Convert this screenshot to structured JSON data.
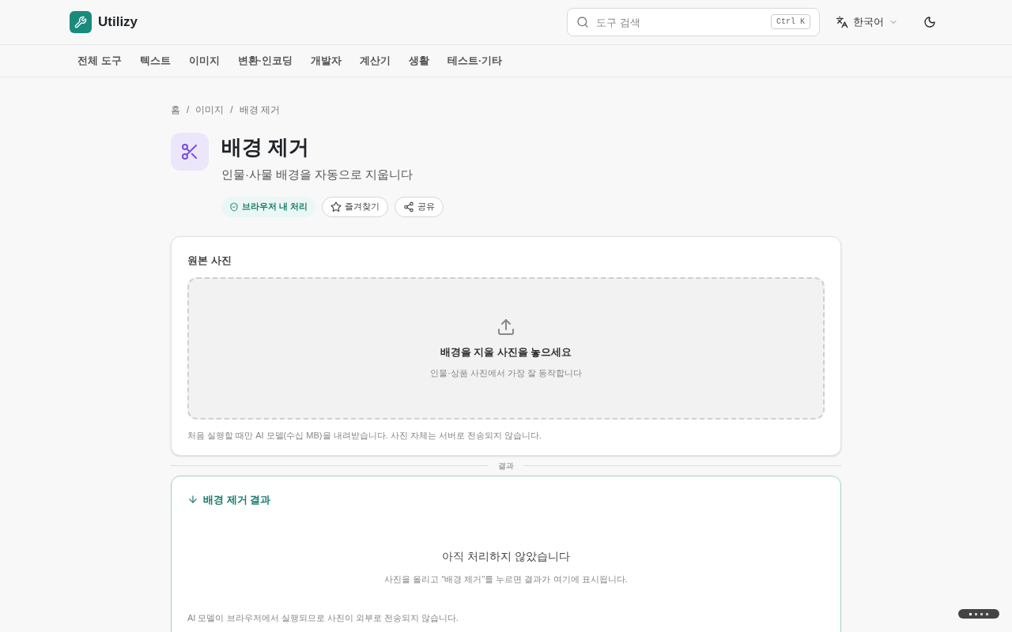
{
  "header": {
    "brand": "Utilizy",
    "search": {
      "placeholder": "도구 검색",
      "shortcut": "Ctrl K"
    },
    "language": "한국어"
  },
  "nav": [
    "전체 도구",
    "텍스트",
    "이미지",
    "변환·인코딩",
    "개발자",
    "계산기",
    "생활",
    "테스트·기타"
  ],
  "breadcrumb": {
    "separator": "/",
    "items": [
      "홈",
      "이미지",
      "배경 제거"
    ]
  },
  "tool": {
    "title": "배경 제거",
    "subtitle": "인물·사물 배경을 자동으로 지웁니다",
    "badge": "브라우저 내 처리",
    "actions": [
      {
        "kind": "favorite",
        "label": "즐겨찾기"
      },
      {
        "kind": "share",
        "label": "공유"
      }
    ]
  },
  "input_card": {
    "title": "원본 사진",
    "dropzone": {
      "title": "배경을 지울 사진을 놓으세요",
      "hint": "인물·상품 사진에서 가장 잘 동작합니다"
    },
    "note": "처음 실행할 때만 AI 모델(수십 MB)을 내려받습니다. 사진 자체는 서버로 전송되지 않습니다."
  },
  "divider": "결과",
  "result_card": {
    "title": "배경 제거 결과",
    "empty_title": "아직 처리하지 않았습니다",
    "empty_hint": "사진을 올리고 \"배경 제거\"를 누르면 결과가 여기에 표시됩니다.",
    "note": "AI 모델이 브라우저에서 실행되므로 사진이 외부로 전송되지 않습니다."
  }
}
